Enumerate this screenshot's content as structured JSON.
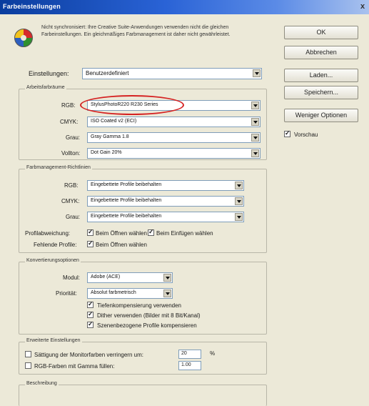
{
  "window": {
    "title": "Farbeinstellungen",
    "close_label": "x"
  },
  "notice": {
    "text": "Nicht synchronisiert: Ihre Creative Suite-Anwendungen verwenden nicht die gleichen Farbeinstellungen. Ein gleichmäßiges Farbmanagement ist daher nicht gewährleistet."
  },
  "settings": {
    "label": "Einstellungen:",
    "value": "Benutzerdefiniert"
  },
  "workspaces": {
    "title": "Arbeitsfarbräume",
    "rgb": {
      "label": "RGB:",
      "value": "StylusPhotoR220 R230 Series"
    },
    "cmyk": {
      "label": "CMYK:",
      "value": "ISO Coated v2 (ECI)"
    },
    "gray": {
      "label": "Grau:",
      "value": "Gray Gamma 1.8"
    },
    "spot": {
      "label": "Vollton:",
      "value": "Dot Gain 20%"
    }
  },
  "policies": {
    "title": "Farbmanagement-Richtlinien",
    "rgb": {
      "label": "RGB:",
      "value": "Eingebettete Profile beibehalten"
    },
    "cmyk": {
      "label": "CMYK:",
      "value": "Eingebettete Profile beibehalten"
    },
    "gray": {
      "label": "Grau:",
      "value": "Eingebettete Profile beibehalten"
    },
    "mismatch": {
      "label": "Profilabweichung:",
      "open": "Beim Öffnen wählen",
      "paste": "Beim Einfügen wählen"
    },
    "missing": {
      "label": "Fehlende Profile:",
      "open": "Beim Öffnen wählen"
    }
  },
  "conversion": {
    "title": "Konvertierungsoptionen",
    "engine": {
      "label": "Modul:",
      "value": "Adobe (ACE)"
    },
    "intent": {
      "label": "Priorität:",
      "value": "Absolut farbmetrisch"
    },
    "bpc": "Tiefenkompensierung verwenden",
    "dither": "Dither verwenden (Bilder mit 8 Bit/Kanal)",
    "scene": "Szenenbezogene Profile kompensieren"
  },
  "advanced": {
    "title": "Erweiterte Einstellungen",
    "desaturate": {
      "label": "Sättigung der Monitorfarben verringern um:",
      "value": "20",
      "unit": "%"
    },
    "blend": {
      "label": "RGB-Farben mit Gamma füllen:",
      "value": "1.00"
    }
  },
  "description": {
    "title": "Beschreibung"
  },
  "buttons": {
    "ok": "OK",
    "cancel": "Abbrechen",
    "load": "Laden...",
    "save": "Speichern...",
    "fewer": "Weniger Optionen"
  },
  "preview": {
    "label": "Vorschau"
  }
}
